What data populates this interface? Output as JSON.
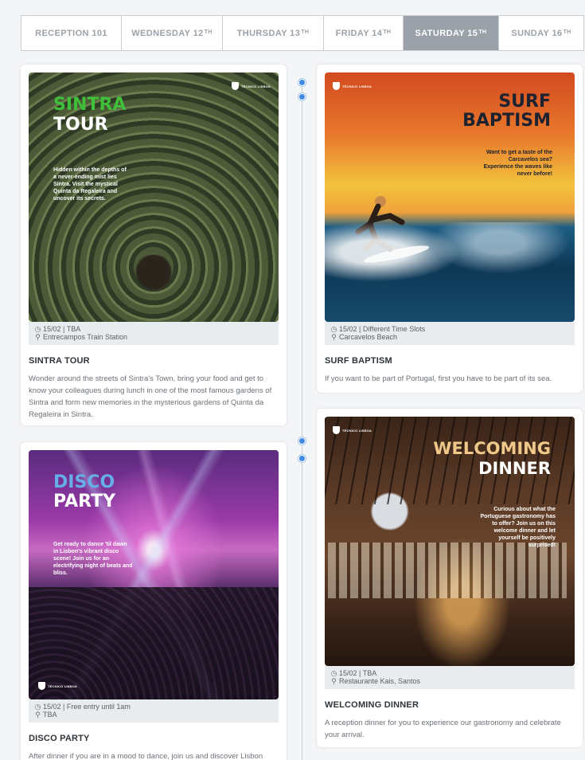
{
  "tabs": [
    {
      "day": "RECEPTION 101",
      "sup": ""
    },
    {
      "day": "WEDNESDAY 12",
      "sup": "TH"
    },
    {
      "day": "THURSDAY 13",
      "sup": "TH"
    },
    {
      "day": "FRIDAY 14",
      "sup": "TH"
    },
    {
      "day": "SATURDAY 15",
      "sup": "TH"
    },
    {
      "day": "SUNDAY 16",
      "sup": "TH"
    }
  ],
  "active_tab": "SATURDAY 15TH",
  "brand": "TÉCNICO LISBOA",
  "events": [
    {
      "poster_title_1": "SINTRA",
      "poster_title_2": "TOUR",
      "poster_blurb": "Hidden within the depths of a never-ending mist lies Sintra. Visit the mystical Quinta da Regaleira and uncover its secrets.",
      "when": "15/02 | TBA",
      "where": "Entrecampos Train Station",
      "title": "SINTRA TOUR",
      "description": "Wonder around the streets of Sintra's Town, bring your food and get to know your colleagues during lunch in one of the most famous gardens of Sintra and form new memories in the mysterious gardens of Quinta da Regaleira in Sintra."
    },
    {
      "poster_title_1": "SURF",
      "poster_title_2": "BAPTISM",
      "poster_blurb": "Want to get a taste of the Carcavelos sea? Experience the waves like never before!",
      "when": "15/02 | Different Time Slots",
      "where": "Carcavelos Beach",
      "title": "SURF BAPTISM",
      "description": "If you want to be part of Portugal, first you have to be part of its sea."
    },
    {
      "poster_title_1": "DISCO",
      "poster_title_2": "PARTY",
      "poster_blurb": "Get ready to dance 'til dawn in Lisbon's vibrant disco scene! Join us for an electrifying night of beats and bliss.",
      "when": "15/02 | Free entry until 1am",
      "where": "TBA",
      "title": "DISCO PARTY",
      "description": "After dinner if you are in a mood to dance, join us and discover Lisbon"
    },
    {
      "poster_title_1": "WELCOMING",
      "poster_title_2": "DINNER",
      "poster_blurb": "Curious about what the Portuguese gastronomy has to offer? Join us on this welcome dinner and let yourself be positively surprised!",
      "when": "15/02 | TBA",
      "where": "Restaurante Kais, Santos",
      "title": "WELCOMING DINNER",
      "description": "A reception dinner for you to experience our gastronomy and celebrate your arrival."
    }
  ],
  "colors": {
    "accent_dot": "#3f8be6",
    "tab_active_bg": "#9ba1a8",
    "sintra_green": "#3fbf3a",
    "surf_navy": "#1d2230",
    "disco_blue": "#66aee8",
    "dinner_gold": "#f0c98a"
  }
}
